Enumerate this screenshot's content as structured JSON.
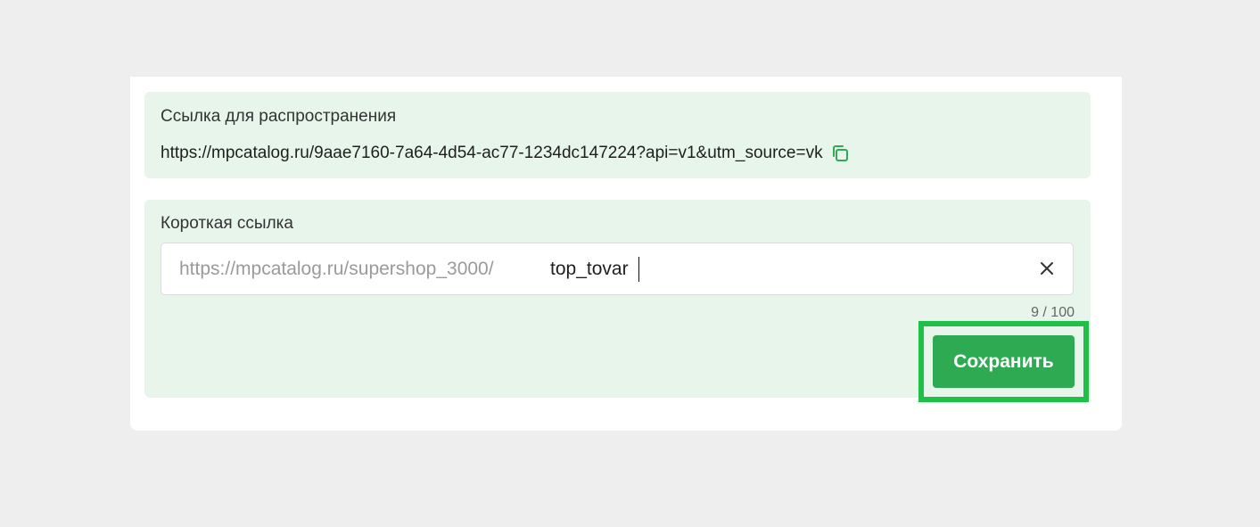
{
  "share_section": {
    "title": "Ссылка для распространения",
    "url": "https://mpcatalog.ru/9aae7160-7a64-4d54-ac77-1234dc147224?api=v1&utm_source=vk",
    "copy_icon": "copy-icon"
  },
  "short_link_section": {
    "title": "Короткая ссылка",
    "prefix": "https://mpcatalog.ru/supershop_3000/",
    "value": "top_tovar",
    "clear_icon": "close-icon",
    "counter": "9 / 100",
    "save_label": "Сохранить"
  },
  "colors": {
    "page_background": "#eeeeee",
    "panel_background": "#e8f5ea",
    "button_green": "#2eaa52",
    "highlight_green": "#1fc047"
  }
}
